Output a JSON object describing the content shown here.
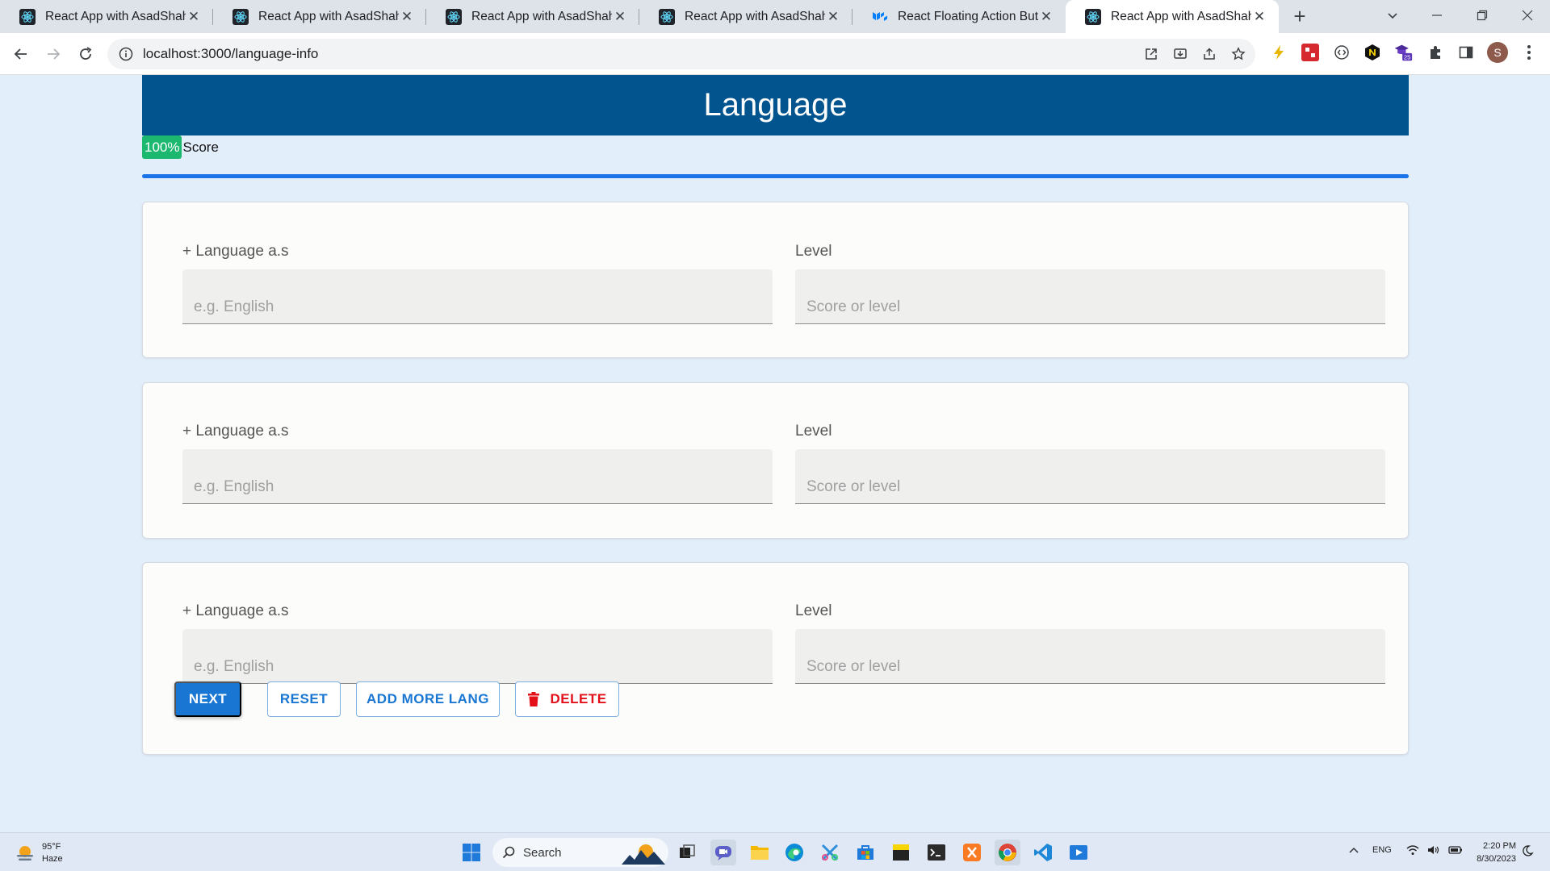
{
  "browser": {
    "tabs": [
      {
        "title": "React App with AsadShahi",
        "icon": "react-icon"
      },
      {
        "title": "React App with AsadShahi",
        "icon": "react-icon"
      },
      {
        "title": "React App with AsadShahi",
        "icon": "react-icon"
      },
      {
        "title": "React App with AsadShahi",
        "icon": "react-icon"
      },
      {
        "title": "React Floating Action Button",
        "icon": "mui-icon"
      },
      {
        "title": "React App with AsadShahi",
        "icon": "react-icon",
        "active": true
      }
    ],
    "url": "localhost:3000/language-info",
    "profile_initial": "S",
    "extension_badge": "25"
  },
  "page": {
    "title": "Language",
    "score": {
      "percent_label": "100%",
      "label": "Score",
      "progress": 1.0
    },
    "entries": [
      {
        "language_label": "+ Language a.s",
        "language_placeholder": "e.g. English",
        "language_value": "",
        "level_label": "Level",
        "level_placeholder": "Score or level",
        "level_value": ""
      },
      {
        "language_label": "+ Language a.s",
        "language_placeholder": "e.g. English",
        "language_value": "",
        "level_label": "Level",
        "level_placeholder": "Score or level",
        "level_value": ""
      },
      {
        "language_label": "+ Language a.s",
        "language_placeholder": "e.g. English",
        "language_value": "",
        "level_label": "Level",
        "level_placeholder": "Score or level",
        "level_value": ""
      }
    ],
    "actions": {
      "next": "NEXT",
      "reset": "RESET",
      "add_more": "ADD MORE LANG",
      "delete": "DELETE"
    }
  },
  "taskbar": {
    "weather": {
      "temp": "95°F",
      "condition": "Haze"
    },
    "search_label": "Search",
    "language": "ENG",
    "time": "2:20 PM",
    "date": "8/30/2023"
  },
  "colors": {
    "header_bg": "#01548e",
    "score_badge": "#1db870",
    "progress": "#1a73e8",
    "primary": "#1976d2",
    "danger": "#e3101a",
    "page_bg": "#e3eefb"
  }
}
